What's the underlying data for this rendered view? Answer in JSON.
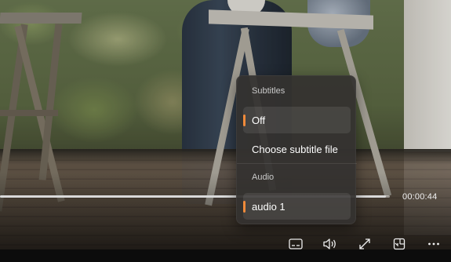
{
  "player": {
    "progress_fraction": 0.99,
    "current_time": "00:00:44"
  },
  "menu": {
    "subtitles_heading": "Subtitles",
    "subtitle_items": [
      {
        "label": "Off",
        "selected": true
      },
      {
        "label": "Choose subtitle file",
        "selected": false
      }
    ],
    "audio_heading": "Audio",
    "audio_items": [
      {
        "label": "audio 1",
        "selected": true
      }
    ]
  },
  "controls": {
    "icons": [
      "subtitles-icon",
      "volume-icon",
      "fullscreen-icon",
      "miniplayer-icon",
      "more-icon"
    ]
  },
  "colors": {
    "accent": "#f08a3a",
    "menu_bg": "#343230"
  }
}
